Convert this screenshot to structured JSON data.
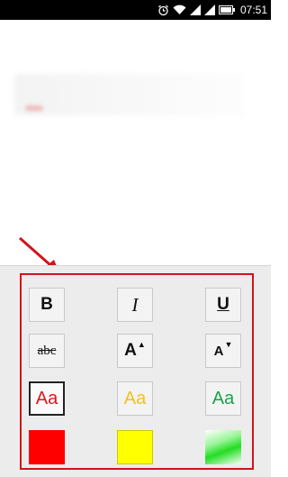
{
  "status_bar": {
    "time": "07:51",
    "icons": [
      "alarm-icon",
      "wifi-icon",
      "signal-icon",
      "signal-icon-2",
      "battery-icon"
    ]
  },
  "format_panel": {
    "style_buttons": [
      {
        "name": "bold-button",
        "label": "B"
      },
      {
        "name": "italic-button",
        "label": "I"
      },
      {
        "name": "underline-button",
        "label": "U"
      }
    ],
    "text_buttons": [
      {
        "name": "strikethrough-button",
        "label": "abc"
      },
      {
        "name": "increase-font-button",
        "label": "A"
      },
      {
        "name": "decrease-font-button",
        "label": "A"
      }
    ],
    "color_text_buttons": [
      {
        "name": "red-text-button",
        "label": "Aa",
        "color": "#e0161c",
        "selected": true
      },
      {
        "name": "yellow-text-button",
        "label": "Aa",
        "color": "#f0c020",
        "selected": false
      },
      {
        "name": "green-text-button",
        "label": "Aa",
        "color": "#17a34a",
        "selected": false
      }
    ],
    "color_swatches": [
      {
        "name": "red-swatch",
        "color": "#ff0000"
      },
      {
        "name": "yellow-swatch",
        "color": "#ffff00"
      },
      {
        "name": "green-swatch",
        "color": "#22dd22"
      }
    ],
    "highlight_color": "#d1141c"
  }
}
